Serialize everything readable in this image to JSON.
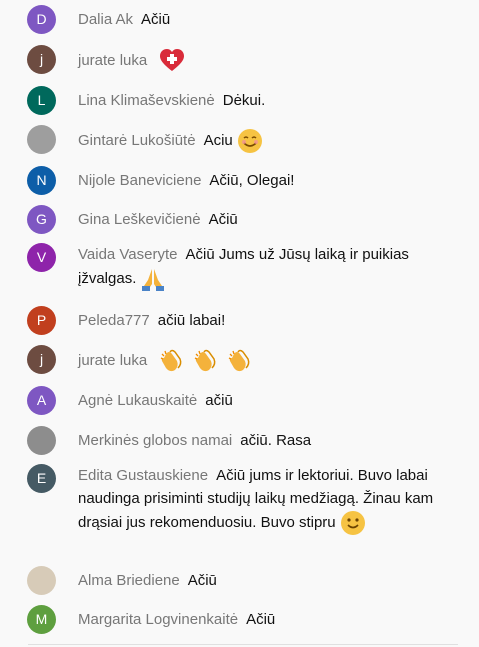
{
  "messages": [
    {
      "author": "Dalia Ak",
      "text": "Ačiū",
      "avatar_letter": "D",
      "avatar_color": "#7e57c2"
    },
    {
      "author": "jurate luka",
      "text": "",
      "avatar_letter": "j",
      "avatar_color": "#6d4c41",
      "emoji": [
        "heart-plus-icon"
      ]
    },
    {
      "author": "Lina Klimaševskienė",
      "text": "Dėkui.",
      "avatar_letter": "L",
      "avatar_color": "#00695c"
    },
    {
      "author": "Gintarė Lukošiūtė",
      "text": "Aciu",
      "avatar_letter": "",
      "avatar_color": "#9e9e9e",
      "emoji": [
        "smiling-face-icon"
      ],
      "photo": true
    },
    {
      "author": "Nijole Baneviciene",
      "text": "Ačiū, Olegai!",
      "avatar_letter": "N",
      "avatar_color": "#0d5ea8"
    },
    {
      "author": "Gina Leškevičienė",
      "text": "Ačiū",
      "avatar_letter": "G",
      "avatar_color": "#7e57c2"
    },
    {
      "author": "Vaida Vaseryte",
      "text": "Ačiū Jums už Jūsų laiką ir puikias įžvalgas.",
      "avatar_letter": "V",
      "avatar_color": "#8e24aa",
      "emoji": [
        "folded-hands-icon"
      ]
    },
    {
      "author": "Peleda777",
      "text": "ačiū labai!",
      "avatar_letter": "P",
      "avatar_color": "#c13f1e"
    },
    {
      "author": "jurate luka",
      "text": "",
      "avatar_letter": "j",
      "avatar_color": "#6d4c41",
      "emoji": [
        "clapping-hands-icon",
        "clapping-hands-icon",
        "clapping-hands-icon"
      ]
    },
    {
      "author": "Agnė Lukauskaitė",
      "text": "ačiū",
      "avatar_letter": "A",
      "avatar_color": "#7e57c2"
    },
    {
      "author": "Merkinės globos namai",
      "text": "ačiū. Rasa",
      "avatar_letter": "",
      "avatar_color": "#8d8d8d",
      "photo": true
    },
    {
      "author": "Edita Gustauskiene",
      "text": "Ačiū jums ir lektoriui. Buvo labai naudinga prisiminti studijų laikų medžiagą. Žinau kam drąsiai jus rekomenduosiu. Buvo stipru",
      "avatar_letter": "E",
      "avatar_color": "#455a64",
      "emoji": [
        "slightly-smiling-face-icon"
      ]
    },
    {
      "author": "Alma Briediene",
      "text": "Ačiū",
      "avatar_letter": "",
      "avatar_color": "#d7cbb8",
      "photo": true
    },
    {
      "author": "Margarita Logvinenkaitė",
      "text": "Ačiū",
      "avatar_letter": "M",
      "avatar_color": "#5e9f3f"
    }
  ]
}
